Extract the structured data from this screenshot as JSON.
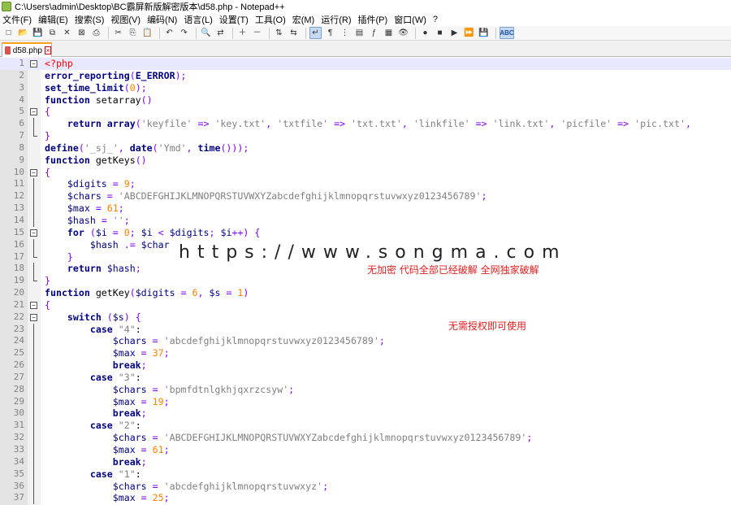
{
  "window": {
    "title": "C:\\Users\\admin\\Desktop\\BC霸屏新版解密版本\\d58.php - Notepad++"
  },
  "menu": [
    "文件(F)",
    "编辑(E)",
    "搜索(S)",
    "视图(V)",
    "编码(N)",
    "语言(L)",
    "设置(T)",
    "工具(O)",
    "宏(M)",
    "运行(R)",
    "插件(P)",
    "窗口(W)",
    "?"
  ],
  "toolbar": {
    "icons": [
      "new-file-icon",
      "open-file-icon",
      "save-icon",
      "save-all-icon",
      "close-icon",
      "close-all-icon",
      "print-icon",
      "sep",
      "cut-icon",
      "copy-icon",
      "paste-icon",
      "sep",
      "undo-icon",
      "redo-icon",
      "sep",
      "find-icon",
      "replace-icon",
      "sep",
      "zoom-in-icon",
      "zoom-out-icon",
      "sep",
      "sync-v-icon",
      "sync-h-icon",
      "sep",
      "word-wrap-icon",
      "show-all-chars-icon",
      "indent-guide-icon",
      "doc-map-icon",
      "function-list-icon",
      "folder-workspace-icon",
      "monitoring-icon",
      "sep",
      "record-macro-icon",
      "stop-macro-icon",
      "play-macro-icon",
      "run-macro-multi-icon",
      "save-macro-icon",
      "sep",
      "spell-check-icon"
    ],
    "glyphs": [
      "□",
      "📂",
      "💾",
      "⧉",
      "✕",
      "⊠",
      "⎙",
      "",
      "✂",
      "⎘",
      "📋",
      "",
      "↶",
      "↷",
      "",
      "🔍",
      "⇄",
      "",
      "＋",
      "－",
      "",
      "⇅",
      "⇆",
      "",
      "↵",
      "¶",
      "⋮",
      "▤",
      "ƒ",
      "▦",
      "👁",
      "",
      "●",
      "■",
      "▶",
      "⏩",
      "💾",
      "",
      "ABC"
    ],
    "active": [
      24,
      38
    ]
  },
  "tab": {
    "label": "d58.php"
  },
  "editor": {
    "lines": [
      {
        "n": "1",
        "fold": "box-minus",
        "text": "<?php"
      },
      {
        "n": "2",
        "fold": "none",
        "text": "error_reporting(E_ERROR);"
      },
      {
        "n": "3",
        "fold": "none",
        "text": "set_time_limit(0);"
      },
      {
        "n": "4",
        "fold": "none",
        "text": "function setarray()"
      },
      {
        "n": "5",
        "fold": "box-minus",
        "text": "{"
      },
      {
        "n": "6",
        "fold": "vline",
        "text": "    return array('keyfile' => 'key.txt', 'txtfile' => 'txt.txt', 'linkfile' => 'link.txt', 'picfile' => 'pic.txt',"
      },
      {
        "n": "7",
        "fold": "end",
        "text": "}"
      },
      {
        "n": "8",
        "fold": "none",
        "text": "define('_sj_', date('Ymd', time()));"
      },
      {
        "n": "9",
        "fold": "none",
        "text": "function getKeys()"
      },
      {
        "n": "10",
        "fold": "box-minus",
        "text": "{"
      },
      {
        "n": "11",
        "fold": "vline",
        "text": "    $digits = 9;"
      },
      {
        "n": "12",
        "fold": "vline",
        "text": "    $chars = 'ABCDEFGHIJKLMNOPQRSTUVWXYZabcdefghijklmnopqrstuvwxyz0123456789';"
      },
      {
        "n": "13",
        "fold": "vline",
        "text": "    $max = 61;"
      },
      {
        "n": "14",
        "fold": "vline",
        "text": "    $hash = '';"
      },
      {
        "n": "15",
        "fold": "box-minus",
        "text": "    for ($i = 0; $i < $digits; $i++) {"
      },
      {
        "n": "16",
        "fold": "vline",
        "text": "        $hash .= $char"
      },
      {
        "n": "17",
        "fold": "end",
        "text": "    }"
      },
      {
        "n": "18",
        "fold": "vline",
        "text": "    return $hash;"
      },
      {
        "n": "19",
        "fold": "end",
        "text": "}"
      },
      {
        "n": "20",
        "fold": "none",
        "text": "function getKey($digits = 6, $s = 1)"
      },
      {
        "n": "21",
        "fold": "box-minus",
        "text": "{"
      },
      {
        "n": "22",
        "fold": "box-minus",
        "text": "    switch ($s) {"
      },
      {
        "n": "23",
        "fold": "vline",
        "text": "        case \"4\":"
      },
      {
        "n": "24",
        "fold": "vline",
        "text": "            $chars = 'abcdefghijklmnopqrstuvwxyz0123456789';"
      },
      {
        "n": "25",
        "fold": "vline",
        "text": "            $max = 37;"
      },
      {
        "n": "26",
        "fold": "vline",
        "text": "            break;"
      },
      {
        "n": "27",
        "fold": "vline",
        "text": "        case \"3\":"
      },
      {
        "n": "28",
        "fold": "vline",
        "text": "            $chars = 'bpmfdtnlgkhjqxrzcsyw';"
      },
      {
        "n": "29",
        "fold": "vline",
        "text": "            $max = 19;"
      },
      {
        "n": "30",
        "fold": "vline",
        "text": "            break;"
      },
      {
        "n": "31",
        "fold": "vline",
        "text": "        case \"2\":"
      },
      {
        "n": "32",
        "fold": "vline",
        "text": "            $chars = 'ABCDEFGHIJKLMNOPQRSTUVWXYZabcdefghijklmnopqrstuvwxyz0123456789';"
      },
      {
        "n": "33",
        "fold": "vline",
        "text": "            $max = 61;"
      },
      {
        "n": "34",
        "fold": "vline",
        "text": "            break;"
      },
      {
        "n": "35",
        "fold": "vline",
        "text": "        case \"1\":"
      },
      {
        "n": "36",
        "fold": "vline",
        "text": "            $chars = 'abcdefghijklmnopqrstuvwxyz';"
      },
      {
        "n": "37",
        "fold": "vline",
        "text": "            $max = 25;"
      }
    ]
  },
  "overlay": {
    "watermark": "https://www.songma.com",
    "note1": "无加密  代码全部已经破解 全网独家破解",
    "note2": "无需授权即可使用"
  },
  "colors": {
    "keyword": "#000080",
    "string": "#808080",
    "number": "#ff8000",
    "php_tag": "#ff0000",
    "note": "#e02020",
    "tab_accent": "#f7a31d"
  }
}
